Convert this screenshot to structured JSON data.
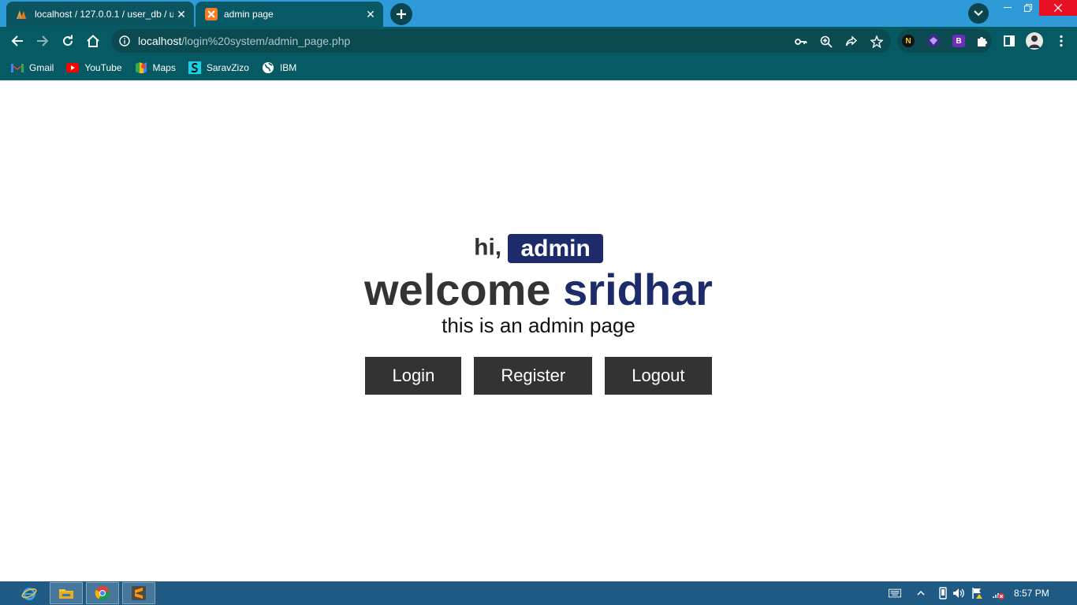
{
  "browser": {
    "tabs": [
      {
        "title": "localhost / 127.0.0.1 / user_db / u",
        "icon": "phpmyadmin-icon",
        "close": "✕"
      },
      {
        "title": "admin page",
        "icon": "xampp-icon",
        "close": "✕"
      }
    ],
    "url": {
      "host": "localhost",
      "path": "/login%20system/admin_page.php"
    },
    "bookmarks": [
      {
        "label": "Gmail",
        "icon": "gmail-icon"
      },
      {
        "label": "YouTube",
        "icon": "youtube-icon"
      },
      {
        "label": "Maps",
        "icon": "maps-icon"
      },
      {
        "label": "SaravZizo",
        "icon": "saravzizo-icon"
      },
      {
        "label": "IBM",
        "icon": "globe-icon"
      }
    ],
    "extensions": {
      "n": "N",
      "b": "B"
    }
  },
  "page": {
    "greeting": "hi,",
    "role": "admin",
    "welcome": "welcome",
    "username": "sridhar",
    "subtitle": "this is an admin page",
    "buttons": {
      "login": "Login",
      "register": "Register",
      "logout": "Logout"
    }
  },
  "taskbar": {
    "time": "8:57 PM"
  },
  "colors": {
    "accent": "#1d2b6b",
    "button": "#333333",
    "titlebar": "#2f9ad8",
    "toolbar": "#065a64"
  }
}
